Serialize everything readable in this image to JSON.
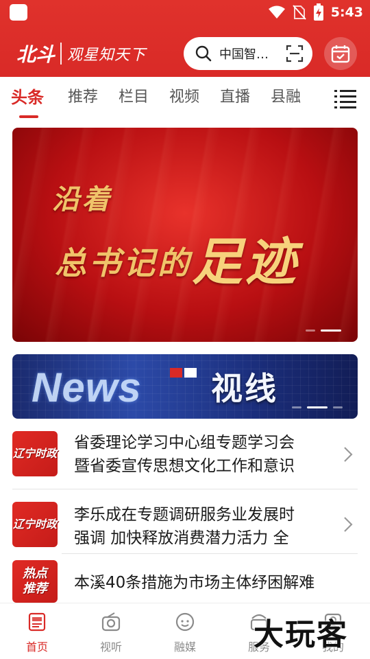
{
  "status_bar": {
    "time": "5:43",
    "icons": [
      "app-square-icon",
      "wifi-icon",
      "no-sim-icon",
      "battery-charging-icon"
    ]
  },
  "header": {
    "logo_name": "北斗",
    "logo_slogan": "观星知天下",
    "search_placeholder": "中国智…",
    "search_icon": "search-icon",
    "scan_icon": "scan-icon",
    "calendar_icon": "calendar-check-icon",
    "brand_color": "#d92a27"
  },
  "tabs": [
    {
      "label": "头条",
      "active": true
    },
    {
      "label": "推荐",
      "active": false
    },
    {
      "label": "栏目",
      "active": false
    },
    {
      "label": "视频",
      "active": false
    },
    {
      "label": "直播",
      "active": false
    },
    {
      "label": "县融",
      "active": false
    }
  ],
  "tabs_menu_icon": "list-menu-icon",
  "banner": {
    "line1": "沿着",
    "line2": "总书记的",
    "big": "足迹",
    "dots": 2,
    "active_dot": 1
  },
  "banner2": {
    "news_text": "News",
    "title": "视线",
    "dots": 3,
    "active_dot": 1
  },
  "news": [
    {
      "thumb": "辽宁时政",
      "title": "省委理论学习中心组专题学习会\n暨省委宣传思想文化工作和意识",
      "has_chevron": true
    },
    {
      "thumb": "辽宁时政",
      "title": "李乐成在专题调研服务业发展时\n强调  加快释放消费潜力活力  全",
      "has_chevron": true
    },
    {
      "thumb": "热点\n推荐",
      "title": "本溪40条措施为市场主体纾困解难",
      "has_chevron": false
    }
  ],
  "bottom_nav": [
    {
      "label": "首页",
      "icon": "home-news-icon",
      "active": true
    },
    {
      "label": "视听",
      "icon": "radio-icon",
      "active": false
    },
    {
      "label": "融媒",
      "icon": "chat-face-icon",
      "active": false
    },
    {
      "label": "服务",
      "icon": "service-icon",
      "active": false
    },
    {
      "label": "我的",
      "icon": "profile-icon",
      "active": false
    }
  ],
  "watermark": "大玩客"
}
